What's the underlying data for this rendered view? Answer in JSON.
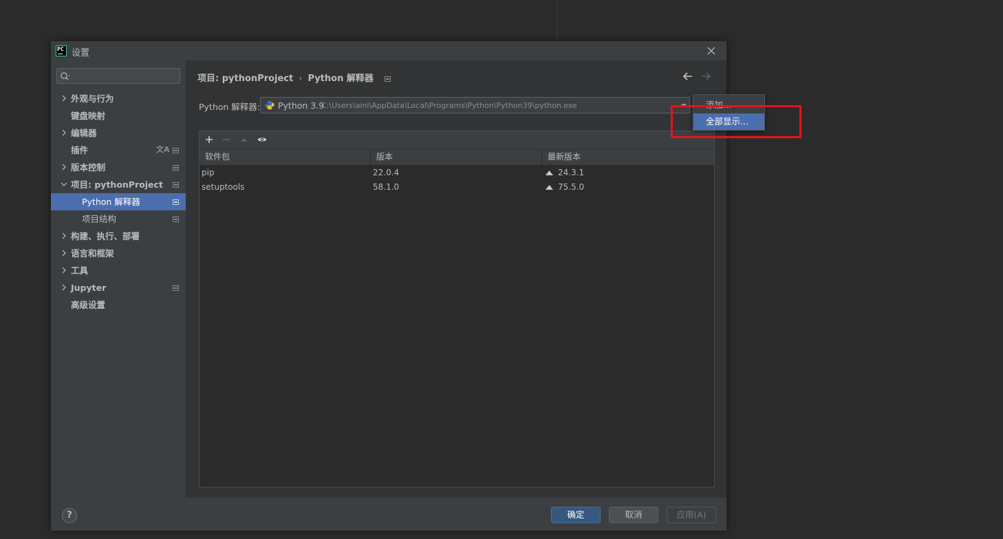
{
  "window": {
    "title": "设置",
    "app_icon_text": "PC"
  },
  "sidebar": {
    "search": {
      "value": "",
      "placeholder": ""
    },
    "items": [
      {
        "label": "外观与行为"
      },
      {
        "label": "键盘映射"
      },
      {
        "label": "编辑器"
      },
      {
        "label": "插件"
      },
      {
        "label": "版本控制"
      },
      {
        "label": "项目: pythonProject"
      },
      {
        "label": "Python 解释器"
      },
      {
        "label": "项目结构"
      },
      {
        "label": "构建、执行、部署"
      },
      {
        "label": "语言和框架"
      },
      {
        "label": "工具"
      },
      {
        "label": "Jupyter"
      },
      {
        "label": "高级设置"
      }
    ]
  },
  "main": {
    "breadcrumb": {
      "parent": "项目: pythonProject",
      "separator": "›",
      "current": "Python 解释器"
    },
    "interpreter": {
      "label": "Python 解释器:",
      "name": "Python 3.9",
      "path": "C:\\Users\\aini\\AppData\\Local\\Programs\\Python\\Python39\\python.exe"
    },
    "packages": {
      "columns": [
        "软件包",
        "版本",
        "最新版本"
      ],
      "rows": [
        {
          "name": "pip",
          "version": "22.0.4",
          "latest": "24.3.1"
        },
        {
          "name": "setuptools",
          "version": "58.1.0",
          "latest": "75.5.0"
        }
      ]
    }
  },
  "popup": {
    "items": [
      "添加...",
      "全部显示..."
    ],
    "highlighted_index": 1
  },
  "footer": {
    "help": "?",
    "ok": "确定",
    "cancel": "取消",
    "apply": "应用(A)"
  },
  "colors": {
    "selection": "#4b6eaf",
    "annotation": "#e8131b",
    "primary_button": "#365880"
  }
}
